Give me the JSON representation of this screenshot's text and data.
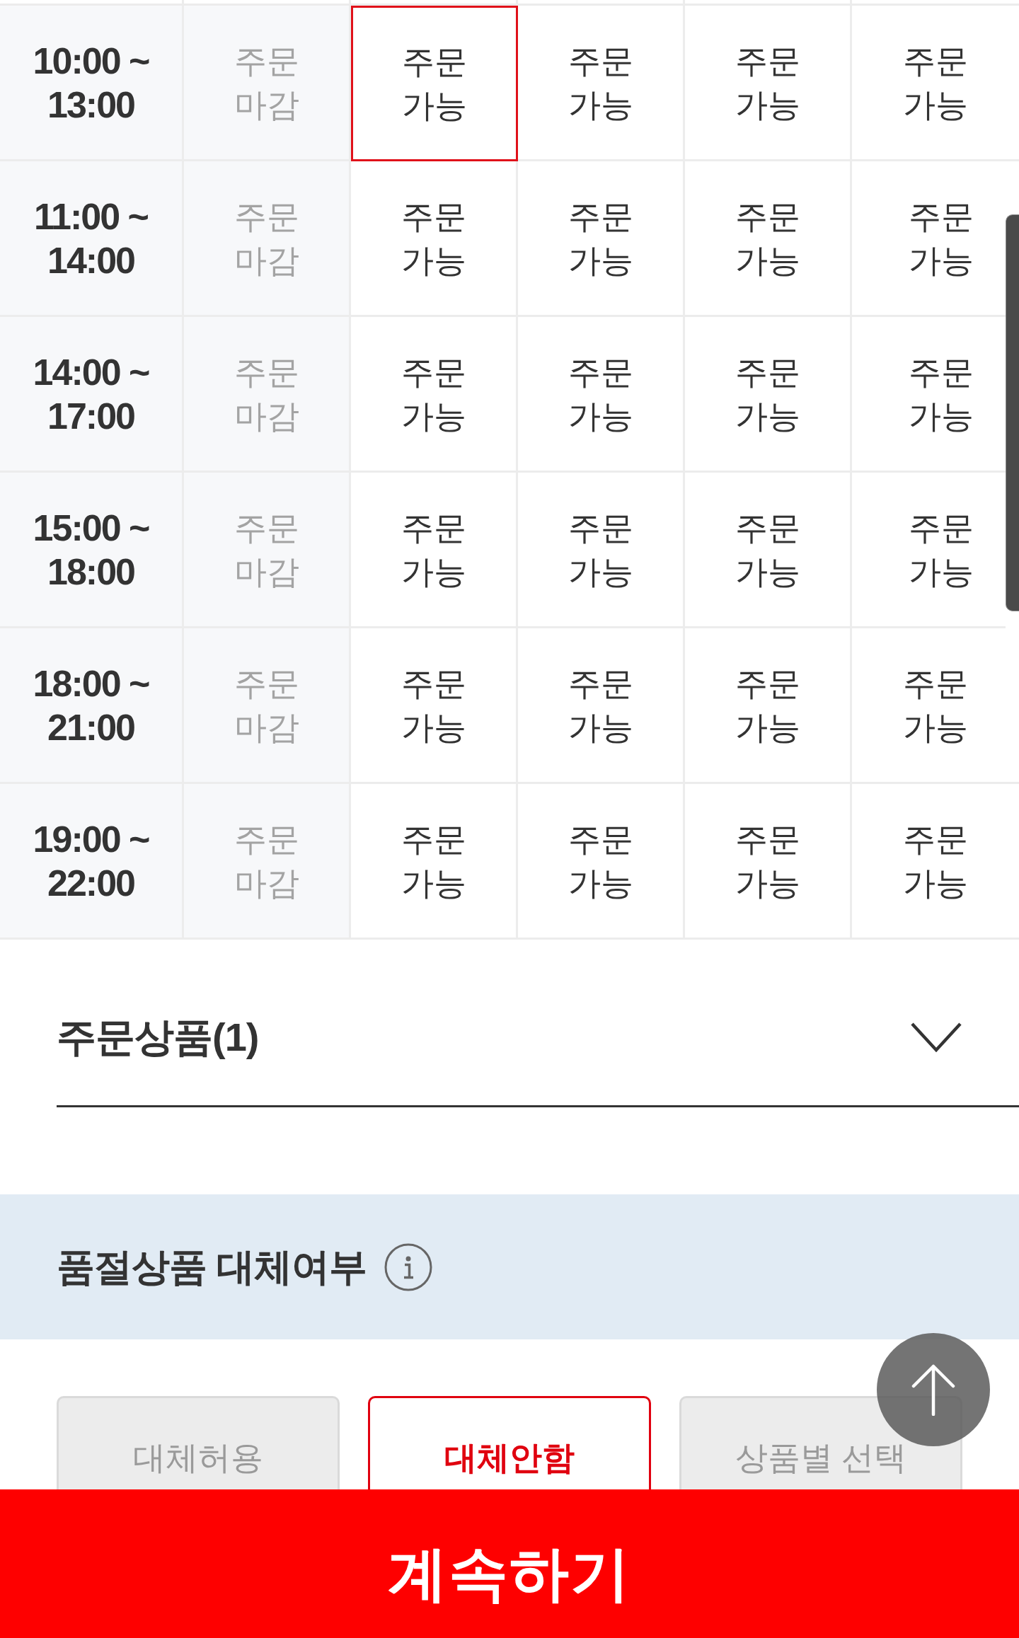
{
  "timetable": {
    "rows": [
      {
        "time": "10:00 ~ 13:00",
        "slots": [
          {
            "label": "주문 마감",
            "open": false,
            "selected": false
          },
          {
            "label": "주문 가능",
            "open": true,
            "selected": true
          },
          {
            "label": "주문 가능",
            "open": true,
            "selected": false
          },
          {
            "label": "주문 가능",
            "open": true,
            "selected": false
          },
          {
            "label": "주문 가능",
            "open": true,
            "selected": false
          }
        ]
      },
      {
        "time": "11:00 ~ 14:00",
        "slots": [
          {
            "label": "주문 마감",
            "open": false,
            "selected": false
          },
          {
            "label": "주문 가능",
            "open": true,
            "selected": false
          },
          {
            "label": "주문 가능",
            "open": true,
            "selected": false
          },
          {
            "label": "주문 가능",
            "open": true,
            "selected": false
          },
          {
            "label": "주문 가능",
            "open": true,
            "selected": false
          }
        ]
      },
      {
        "time": "14:00 ~ 17:00",
        "slots": [
          {
            "label": "주문 마감",
            "open": false,
            "selected": false
          },
          {
            "label": "주문 가능",
            "open": true,
            "selected": false
          },
          {
            "label": "주문 가능",
            "open": true,
            "selected": false
          },
          {
            "label": "주문 가능",
            "open": true,
            "selected": false
          },
          {
            "label": "주문 가능",
            "open": true,
            "selected": false
          }
        ]
      },
      {
        "time": "15:00 ~ 18:00",
        "slots": [
          {
            "label": "주문 마감",
            "open": false,
            "selected": false
          },
          {
            "label": "주문 가능",
            "open": true,
            "selected": false
          },
          {
            "label": "주문 가능",
            "open": true,
            "selected": false
          },
          {
            "label": "주문 가능",
            "open": true,
            "selected": false
          },
          {
            "label": "주문 가능",
            "open": true,
            "selected": false
          }
        ]
      },
      {
        "time": "18:00 ~ 21:00",
        "slots": [
          {
            "label": "주문 마감",
            "open": false,
            "selected": false
          },
          {
            "label": "주문 가능",
            "open": true,
            "selected": false
          },
          {
            "label": "주문 가능",
            "open": true,
            "selected": false
          },
          {
            "label": "주문 가능",
            "open": true,
            "selected": false
          },
          {
            "label": "주문 가능",
            "open": true,
            "selected": false
          }
        ]
      },
      {
        "time": "19:00 ~ 22:00",
        "slots": [
          {
            "label": "주문 마감",
            "open": false,
            "selected": false
          },
          {
            "label": "주문 가능",
            "open": true,
            "selected": false
          },
          {
            "label": "주문 가능",
            "open": true,
            "selected": false
          },
          {
            "label": "주문 가능",
            "open": true,
            "selected": false
          },
          {
            "label": "주문 가능",
            "open": true,
            "selected": false
          }
        ]
      }
    ]
  },
  "order_items": {
    "title": "주문상품(1)",
    "expanded": false
  },
  "substitution": {
    "title": "품절상품 대체여부",
    "options": [
      {
        "label": "대체허용",
        "selected": false
      },
      {
        "label": "대체안함",
        "selected": true
      },
      {
        "label": "상품별 선택",
        "selected": false
      }
    ]
  },
  "continue_button": {
    "label": "계속하기"
  }
}
